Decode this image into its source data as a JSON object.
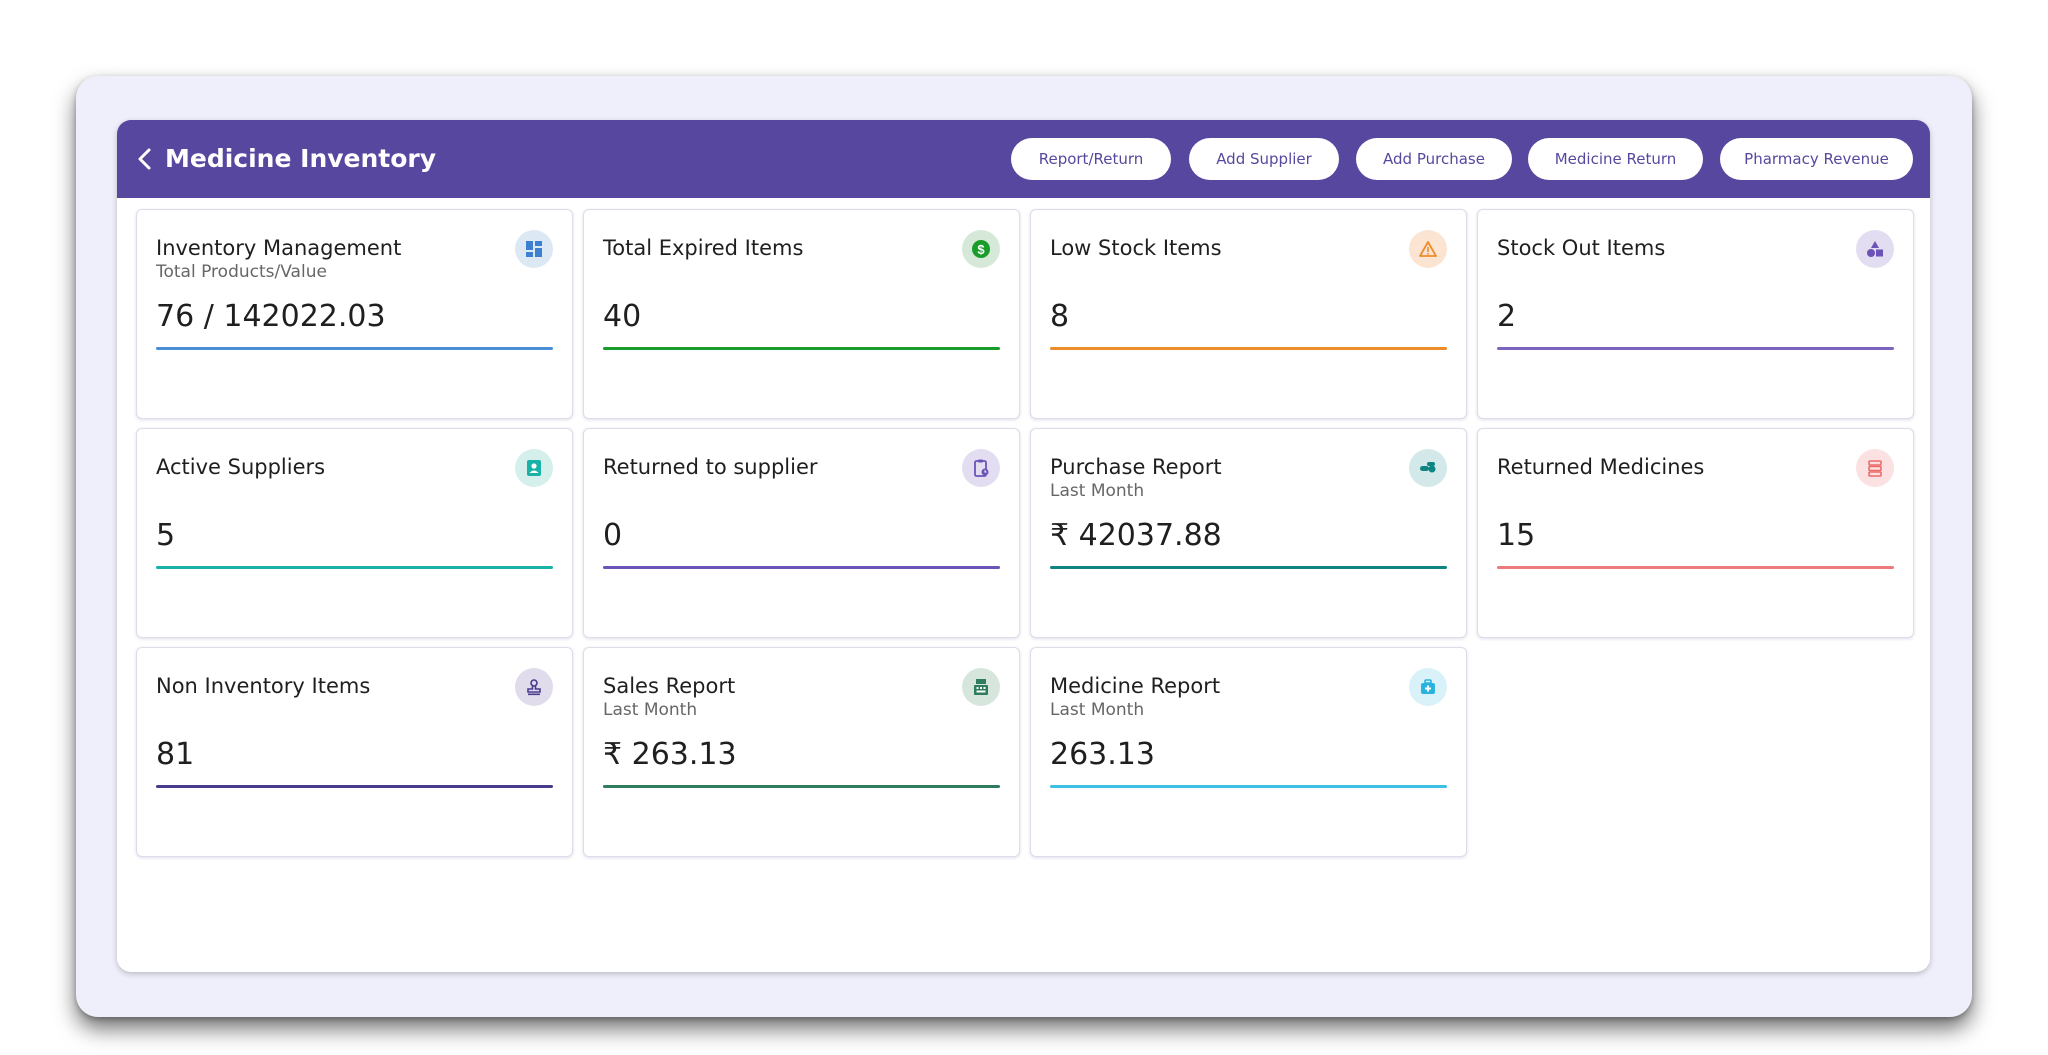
{
  "header": {
    "title": "Medicine Inventory",
    "buttons": [
      "Report/Return",
      "Add Supplier",
      "Add Purchase",
      "Medicine Return",
      "Pharmacy Revenue"
    ]
  },
  "colors": {
    "header_bg": "#58479f",
    "background": "#efeffb"
  },
  "cards": [
    {
      "title": "Inventory Management",
      "subtitle": "Total Products/Value",
      "value": "76 / 142022.03",
      "accent": "#4a8fd6",
      "icon": "dashboard-icon"
    },
    {
      "title": "Total Expired Items",
      "subtitle": "",
      "value": "40",
      "accent": "#1a9c2a",
      "icon": "dollar-icon"
    },
    {
      "title": "Low Stock Items",
      "subtitle": "",
      "value": "8",
      "accent": "#ef8c2a",
      "icon": "warning-icon"
    },
    {
      "title": "Stock Out Items",
      "subtitle": "",
      "value": "2",
      "accent": "#7b64be",
      "icon": "shapes-icon"
    },
    {
      "title": "Active Suppliers",
      "subtitle": "",
      "value": "5",
      "accent": "#18b2a8",
      "icon": "contact-icon"
    },
    {
      "title": "Returned to supplier",
      "subtitle": "",
      "value": "0",
      "accent": "#6b53b8",
      "icon": "clipboard-icon"
    },
    {
      "title": "Purchase Report",
      "subtitle": "Last Month",
      "value": "₹ 42037.88",
      "accent": "#0f8484",
      "icon": "pills-icon"
    },
    {
      "title": "Returned Medicines",
      "subtitle": "",
      "value": "15",
      "accent": "#ee7b7b",
      "icon": "storage-icon"
    },
    {
      "title": "Non Inventory Items",
      "subtitle": "",
      "value": "81",
      "accent": "#4a3a8c",
      "icon": "stamp-icon"
    },
    {
      "title": "Sales Report",
      "subtitle": "Last Month",
      "value": "₹ 263.13",
      "accent": "#2e7d5e",
      "icon": "register-icon"
    },
    {
      "title": "Medicine Report",
      "subtitle": "Last Month",
      "value": "263.13",
      "accent": "#3dbfe6",
      "icon": "medkit-icon"
    }
  ]
}
